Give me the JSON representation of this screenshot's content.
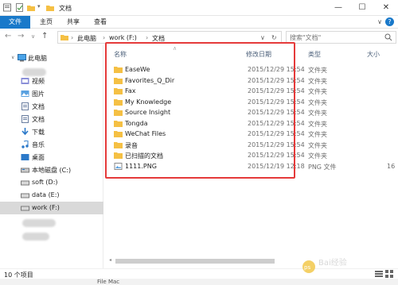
{
  "window": {
    "title": "文档",
    "minimize": "—",
    "maximize": "☐",
    "close": "✕"
  },
  "ribbon": {
    "file": "文件",
    "tabs": [
      "主页",
      "共享",
      "查看"
    ],
    "help": "?"
  },
  "address": {
    "back": "←",
    "forward": "→",
    "recent": "∨",
    "up": "↑",
    "path": [
      "此电脑",
      "work (F:)",
      "文档"
    ],
    "refresh": "↻"
  },
  "search": {
    "placeholder": "搜索\"文档\""
  },
  "nav": {
    "items": [
      {
        "label": "此电脑",
        "icon": "computer-icon"
      },
      {
        "label": "视频",
        "icon": "video-folder-icon"
      },
      {
        "label": "图片",
        "icon": "picture-folder-icon"
      },
      {
        "label": "文档",
        "icon": "document-folder-icon"
      },
      {
        "label": "文档",
        "icon": "document-folder-icon"
      },
      {
        "label": "下载",
        "icon": "download-folder-icon"
      },
      {
        "label": "音乐",
        "icon": "music-folder-icon"
      },
      {
        "label": "桌面",
        "icon": "desktop-folder-icon"
      },
      {
        "label": "本地磁盘 (C:)",
        "icon": "drive-icon"
      },
      {
        "label": "soft (D:)",
        "icon": "drive-icon"
      },
      {
        "label": "data (E:)",
        "icon": "drive-icon"
      },
      {
        "label": "work (F:)",
        "icon": "drive-icon"
      }
    ]
  },
  "columns": {
    "name": "名称",
    "date": "修改日期",
    "type": "类型",
    "size": "大小"
  },
  "files": [
    {
      "name": "EaseWe",
      "date": "2015/12/29 15:54",
      "type": "文件夹",
      "kind": "folder"
    },
    {
      "name": "Favorites_Q_Dir",
      "date": "2015/12/29 15:54",
      "type": "文件夹",
      "kind": "folder"
    },
    {
      "name": "Fax",
      "date": "2015/12/29 15:54",
      "type": "文件夹",
      "kind": "folder"
    },
    {
      "name": "My Knowledge",
      "date": "2015/12/29 15:54",
      "type": "文件夹",
      "kind": "folder"
    },
    {
      "name": "Source Insight",
      "date": "2015/12/29 15:54",
      "type": "文件夹",
      "kind": "folder"
    },
    {
      "name": "Tongda",
      "date": "2015/12/29 15:54",
      "type": "文件夹",
      "kind": "folder"
    },
    {
      "name": "WeChat Files",
      "date": "2015/12/29 15:54",
      "type": "文件夹",
      "kind": "folder"
    },
    {
      "name": "录音",
      "date": "2015/12/29 15:54",
      "type": "文件夹",
      "kind": "folder"
    },
    {
      "name": "已扫描的文档",
      "date": "2015/12/29 15:54",
      "type": "文件夹",
      "kind": "folder"
    },
    {
      "name": "1111.PNG",
      "date": "2015/12/19 12:18",
      "type": "PNG 文件",
      "size": "16",
      "kind": "png"
    }
  ],
  "status": {
    "count": "10 个项目"
  },
  "below": {
    "text": "File Mac"
  },
  "colors": {
    "accent": "#1979ca",
    "folder": "#f5c044",
    "highlight": "#e53a3a"
  }
}
